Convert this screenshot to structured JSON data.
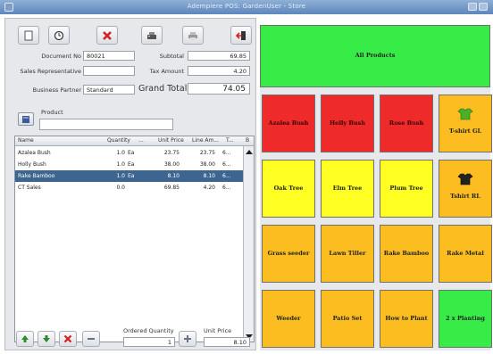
{
  "window": {
    "title": "Adempiere POS: GardenUser - Store"
  },
  "toolbar": {
    "buttons": [
      "new-icon",
      "history-icon",
      "cancel-icon",
      "cash-register-icon",
      "print-icon",
      "logout-icon"
    ]
  },
  "header": {
    "document_no_label": "Document No",
    "document_no": "80021",
    "sales_rep_label": "Sales Representative",
    "sales_rep": "",
    "business_partner_label": "Business Partner",
    "business_partner": "Standard",
    "subtotal_label": "Subtotal",
    "subtotal": "69.85",
    "tax_amount_label": "Tax Amount",
    "tax_amount": "4.20",
    "grand_total_label": "Grand Total",
    "grand_total": "74.05"
  },
  "product": {
    "label": "Product",
    "value": ""
  },
  "table": {
    "columns": [
      "Name",
      "Quantity",
      "...",
      "Unit Price",
      "Line Am...",
      "T...",
      "B"
    ],
    "rows": [
      {
        "name": "Azalea Bush",
        "qty": "1.0",
        "uom": "Ea",
        "price": "23.75",
        "line": "23.75",
        "tax": "6..."
      },
      {
        "name": "Holly Bush",
        "qty": "1.0",
        "uom": "Ea",
        "price": "38.00",
        "line": "38.00",
        "tax": "6..."
      },
      {
        "name": "Rake Bamboo",
        "qty": "1.0",
        "uom": "Ea",
        "price": "8.10",
        "line": "8.10",
        "tax": "6..."
      },
      {
        "name": "CT Sales",
        "qty": "0.0",
        "uom": "",
        "price": "69.85",
        "line": "4.20",
        "tax": "6..."
      }
    ],
    "selected_row": 2
  },
  "bottom": {
    "ordered_quantity_label": "Ordered Quantity",
    "ordered_quantity": "1",
    "unit_price_label": "Unit Price",
    "unit_price": "8.10"
  },
  "products": {
    "all_label": "All Products",
    "tiles": [
      {
        "label": "Azalea Bush",
        "color": "red"
      },
      {
        "label": "Holly Bush",
        "color": "red"
      },
      {
        "label": "Rose Bush",
        "color": "red"
      },
      {
        "label": "T-shirt GL",
        "color": "orange",
        "icon": "green-shirt-icon"
      },
      {
        "label": "Oak Tree",
        "color": "yellow"
      },
      {
        "label": "Elm Tree",
        "color": "yellow"
      },
      {
        "label": "Plum Tree",
        "color": "yellow"
      },
      {
        "label": "Tshirt RL",
        "color": "orange",
        "icon": "black-shirt-icon"
      },
      {
        "label": "Grass seeder",
        "color": "orange"
      },
      {
        "label": "Lawn Tiller",
        "color": "orange"
      },
      {
        "label": "Rake Bamboo",
        "color": "orange"
      },
      {
        "label": "Rake Metal",
        "color": "orange"
      },
      {
        "label": "Weeder",
        "color": "orange"
      },
      {
        "label": "Patio Set",
        "color": "orange"
      },
      {
        "label": "How to Plant",
        "color": "orange"
      },
      {
        "label": "2 x Planting",
        "color": "green"
      }
    ]
  },
  "colors": {
    "red": "#ee2a2a",
    "yellow": "#ffff24",
    "orange": "#fbbd1f",
    "green": "#37ec46",
    "selection": "#3c668f"
  }
}
